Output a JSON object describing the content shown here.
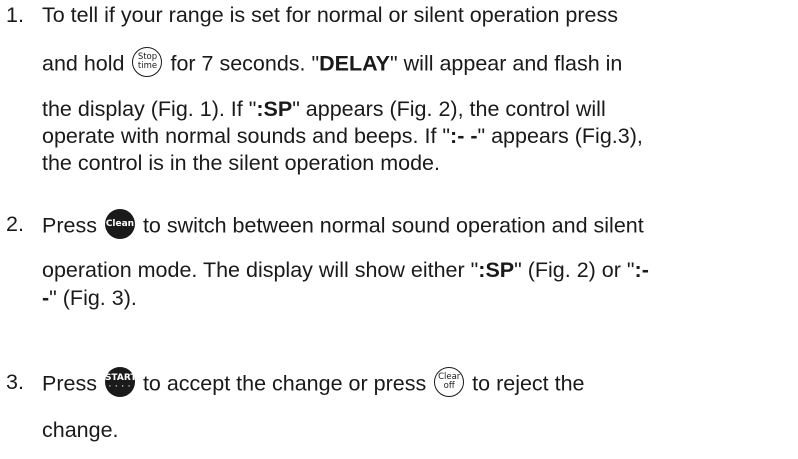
{
  "steps": [
    {
      "number": "1.",
      "line1": "To tell if your range is set for normal or silent operation press",
      "line2_pre": "and hold",
      "line2_post": "for 7 seconds. \"",
      "line2_bold": "DELAY",
      "line2_end": "\" will appear and flash in",
      "line3_pre": "the display (Fig. 1).  If \"",
      "line3_bold": ":SP",
      "line3_end": "\" appears (Fig. 2), the control will",
      "line4_pre": "operate with normal sounds and beeps.  If \"",
      "line4_bold": ":- -",
      "line4_end": "\" appears (Fig.3),",
      "line5": "the control is in the silent operation mode.",
      "button": {
        "icon": "stop-time-button-icon",
        "top": "Stop",
        "bottom": "time"
      }
    },
    {
      "number": "2.",
      "line1_pre": "Press",
      "line1_post": "to switch between normal sound operation and silent",
      "line2_pre": "operation mode. The display will show either \"",
      "line2_bold1": ":SP",
      "line2_mid": "\" (Fig. 2) or \"",
      "line2_bold2": ":-",
      "line3_bold": "-",
      "line3_end": "\" (Fig. 3).",
      "button": {
        "icon": "clean-button-icon",
        "label": "Clean"
      }
    },
    {
      "number": "3.",
      "line1_pre": "Press",
      "line1_mid": "to accept the change or press",
      "line1_post": "to reject the",
      "line2": "change.",
      "start_button": {
        "icon": "start-button-icon",
        "label": "START",
        "dots": "· · · ·"
      },
      "clear_button": {
        "icon": "clear-off-button-icon",
        "top": "Clear",
        "bottom": "off"
      }
    }
  ]
}
